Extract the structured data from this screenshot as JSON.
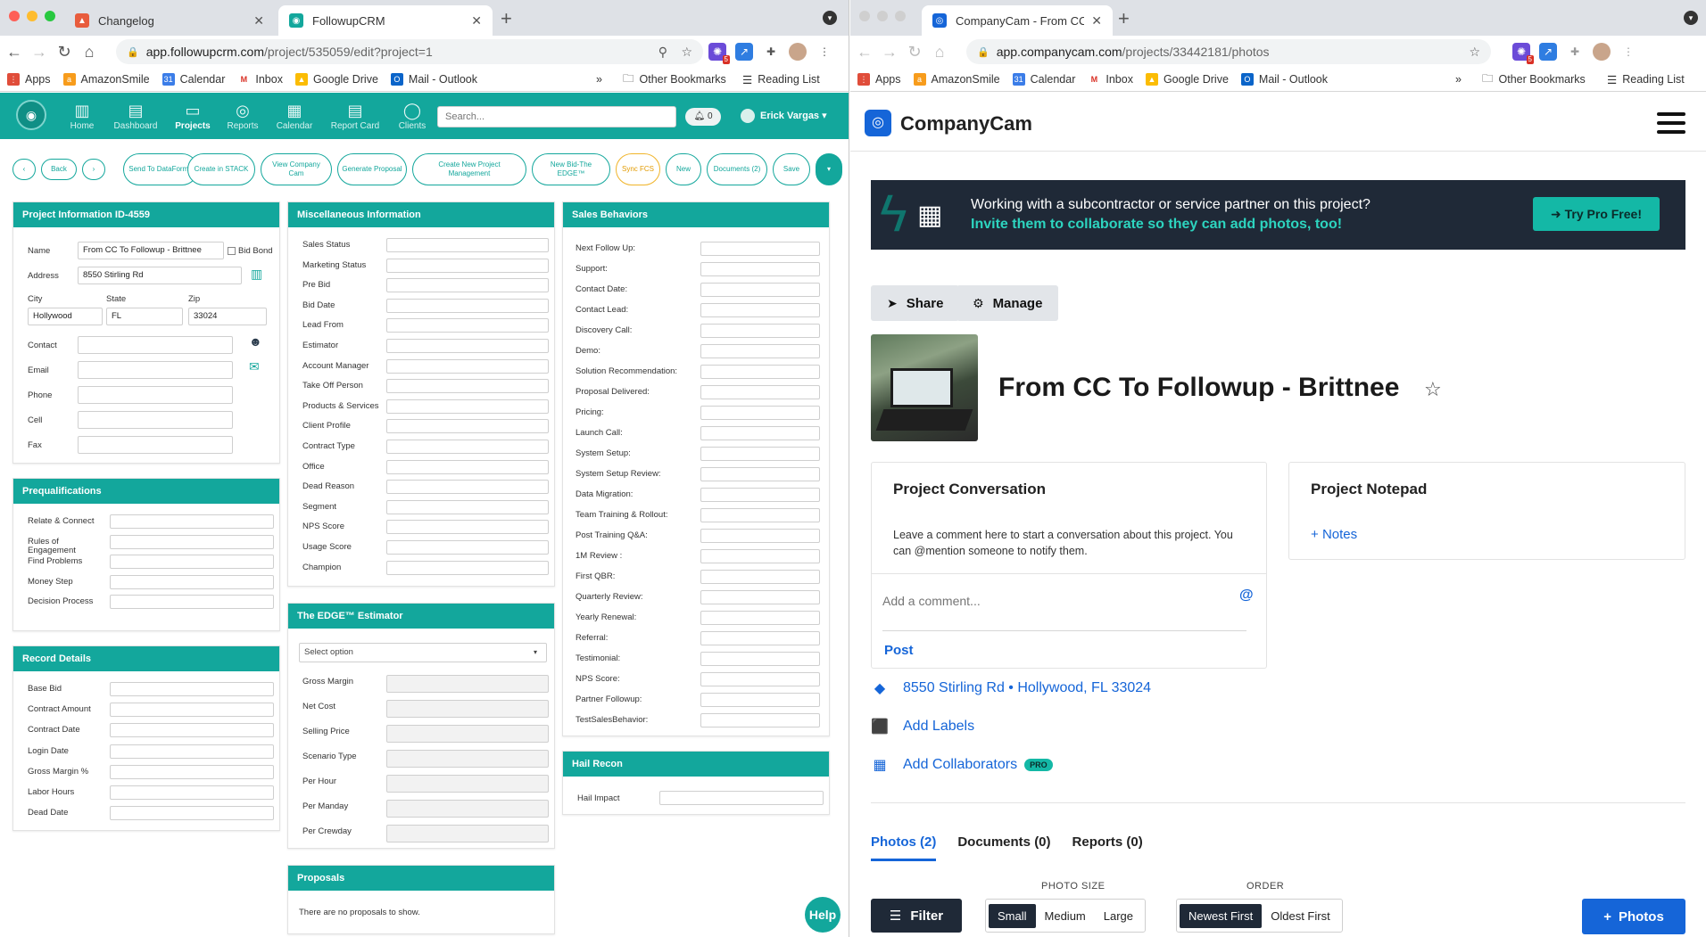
{
  "left_browser": {
    "tabs": [
      {
        "title": "Changelog",
        "active": false
      },
      {
        "title": "FollowupCRM",
        "active": true
      }
    ],
    "url_host": "app.followupcrm.com",
    "url_path": "/project/535059/edit?project=1",
    "ext_badge": "5",
    "bookmarks": [
      "Apps",
      "AmazonSmile",
      "Calendar",
      "Inbox",
      "Google Drive",
      "Mail - Outlook"
    ],
    "bookmarks_more": "»",
    "other_bookmarks": "Other Bookmarks",
    "reading_list": "Reading List"
  },
  "crm": {
    "nav": [
      "Home",
      "Dashboard",
      "Projects",
      "Reports",
      "Calendar",
      "Report Card",
      "Clients"
    ],
    "active_nav": "Projects",
    "search_placeholder": "Search...",
    "notifications": "0",
    "user": "Erick Vargas",
    "actions": {
      "back": "Back",
      "send_dataforma": "Send To DataForma",
      "create_stack": "Create in STACK",
      "view_companycam": "View Company Cam",
      "generate_proposal": "Generate Proposal",
      "create_project_mgmt": "Create New Project Management",
      "new_bid": "New Bid-The EDGE™",
      "sync_fcs": "Sync FCS",
      "new": "New",
      "documents": "Documents (2)",
      "save": "Save"
    },
    "project_info": {
      "title": "Project Information ID-4559",
      "name_label": "Name",
      "name_value": "From CC To Followup - Brittnee",
      "bid_bond": "Bid Bond",
      "address_label": "Address",
      "address_value": "8550 Stirling Rd",
      "city_label": "City",
      "city_value": "Hollywood",
      "state_label": "State",
      "state_value": "FL",
      "zip_label": "Zip",
      "zip_value": "33024",
      "contact_label": "Contact",
      "email_label": "Email",
      "phone_label": "Phone",
      "cell_label": "Cell",
      "fax_label": "Fax"
    },
    "prequal": {
      "title": "Prequalifications",
      "fields": [
        "Relate & Connect",
        "Rules of Engagement",
        "Find Problems",
        "Money Step",
        "Decision Process"
      ]
    },
    "record": {
      "title": "Record Details",
      "fields": [
        "Base Bid",
        "Contract Amount",
        "Contract Date",
        "Login Date",
        "Gross Margin %",
        "Labor Hours",
        "Dead Date"
      ]
    },
    "misc": {
      "title": "Miscellaneous Information",
      "fields": [
        "Sales Status",
        "Marketing Status",
        "Pre Bid",
        "Bid Date",
        "Lead From",
        "Estimator",
        "Account Manager",
        "Take Off Person",
        "Products & Services",
        "Client Profile",
        "Contract Type",
        "Office",
        "Dead Reason",
        "Segment",
        "NPS Score",
        "Usage Score",
        "Champion"
      ]
    },
    "edge": {
      "title": "The EDGE™ Estimator",
      "select": "Select option",
      "fields": [
        "Gross Margin",
        "Net Cost",
        "Selling Price",
        "Scenario Type",
        "Per Hour",
        "Per Manday",
        "Per Crewday"
      ]
    },
    "proposals": {
      "title": "Proposals",
      "empty": "There are no proposals to show."
    },
    "sales": {
      "title": "Sales Behaviors",
      "fields": [
        "Next Follow Up:",
        "Support:",
        "Contact Date:",
        "Contact Lead:",
        "Discovery Call:",
        "Demo:",
        "Solution Recommendation:",
        "Proposal Delivered:",
        "Pricing:",
        "Launch Call:",
        "System Setup:",
        "System Setup Review:",
        "Data Migration:",
        "Team Training & Rollout:",
        "Post Training Q&A:",
        "1M Review :",
        "First QBR:",
        "Quarterly Review:",
        "Yearly Renewal:",
        "Referral:",
        "Testimonial:",
        "NPS Score:",
        "Partner Followup:",
        "TestSalesBehavior:"
      ]
    },
    "hail": {
      "title": "Hail Recon",
      "field": "Hail Impact"
    },
    "help": "Help"
  },
  "right_browser": {
    "tab_title": "CompanyCam - From CC To Fo",
    "url_host": "app.companycam.com",
    "url_path": "/projects/33442181/photos",
    "ext_badge": "5",
    "bookmarks": [
      "Apps",
      "AmazonSmile",
      "Calendar",
      "Inbox",
      "Google Drive",
      "Mail - Outlook"
    ],
    "bookmarks_more": "»",
    "other_bookmarks": "Other Bookmarks",
    "reading_list": "Reading List"
  },
  "cc": {
    "brand": "CompanyCam",
    "promo_line1": "Working with a subcontractor or service partner on this project?",
    "promo_line2": "Invite them to collaborate so they can add photos, too!",
    "try_pro": "Try Pro Free!",
    "share": "Share",
    "manage": "Manage",
    "project_title": "From CC To Followup - Brittnee",
    "conversation_title": "Project Conversation",
    "conversation_desc": "Leave a comment here to start a conversation about this project. You can @mention someone to notify them.",
    "comment_placeholder": "Add a comment...",
    "post": "Post",
    "notepad_title": "Project Notepad",
    "notes": "Notes",
    "address": "8550 Stirling Rd • Hollywood, FL 33024",
    "add_labels": "Add Labels",
    "add_collaborators": "Add Collaborators",
    "pro_badge": "PRO",
    "tabs": [
      "Photos (2)",
      "Documents (0)",
      "Reports (0)"
    ],
    "photo_size_label": "PHOTO SIZE",
    "sizes": [
      "Small",
      "Medium",
      "Large"
    ],
    "order_label": "ORDER",
    "orders": [
      "Newest First",
      "Oldest First"
    ],
    "filter": "Filter",
    "add_photos": "Photos"
  },
  "colors": {
    "crm_teal": "#13a79c",
    "cc_blue": "#1565d8",
    "cc_dark": "#1f2937",
    "cc_accent": "#14b8a6"
  }
}
